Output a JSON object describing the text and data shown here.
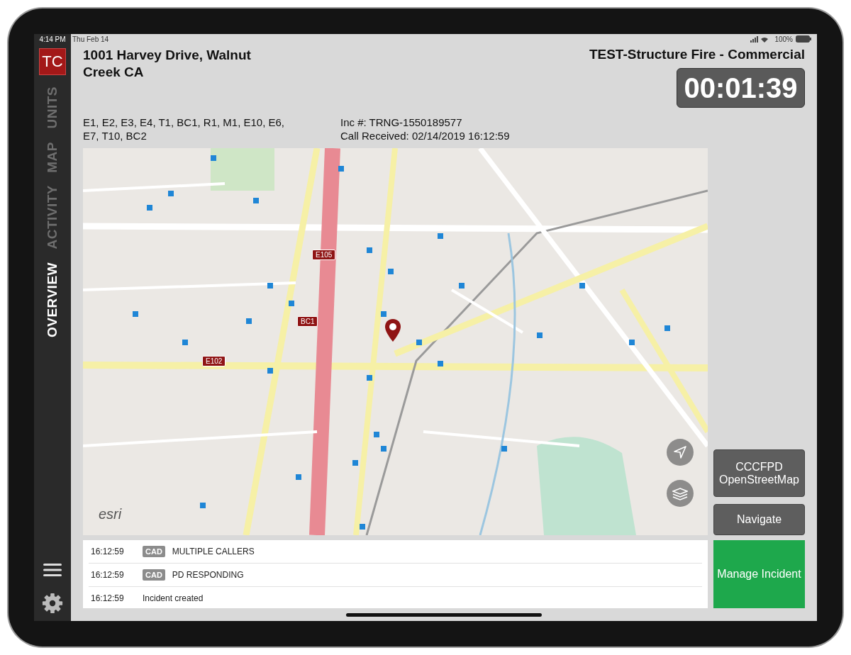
{
  "status_bar": {
    "time": "4:14 PM",
    "date": "Thu Feb 14",
    "battery": "100%"
  },
  "sidebar": {
    "logo": "TC",
    "tabs": [
      {
        "label": "UNITS",
        "selected": false
      },
      {
        "label": "MAP",
        "selected": false
      },
      {
        "label": "ACTIVITY",
        "selected": false
      },
      {
        "label": "OVERVIEW",
        "selected": true
      }
    ]
  },
  "header": {
    "address": "1001 Harvey Drive, Walnut Creek CA",
    "incident_type": "TEST-Structure Fire - Commercial",
    "timer": "00:01:39",
    "units": "E1, E2, E3, E4, T1, BC1, R1, M1, E10, E6, E7, T10, BC2",
    "incident_number": "Inc #: TRNG-1550189577",
    "call_received": "Call Received: 02/14/2019 16:12:59"
  },
  "map": {
    "unit_markers": [
      {
        "label": "E105"
      },
      {
        "label": "BC1"
      },
      {
        "label": "E102"
      }
    ],
    "attribution": "esri"
  },
  "map_buttons": [
    "CCCFPD OpenStreetMap",
    "Navigate"
  ],
  "log": [
    {
      "time": "16:12:59",
      "source": "CAD",
      "message": "MULTIPLE CALLERS"
    },
    {
      "time": "16:12:59",
      "source": "CAD",
      "message": "PD RESPONDING"
    },
    {
      "time": "16:12:59",
      "message": "Incident created"
    }
  ],
  "primary_button": "Manage Incident"
}
